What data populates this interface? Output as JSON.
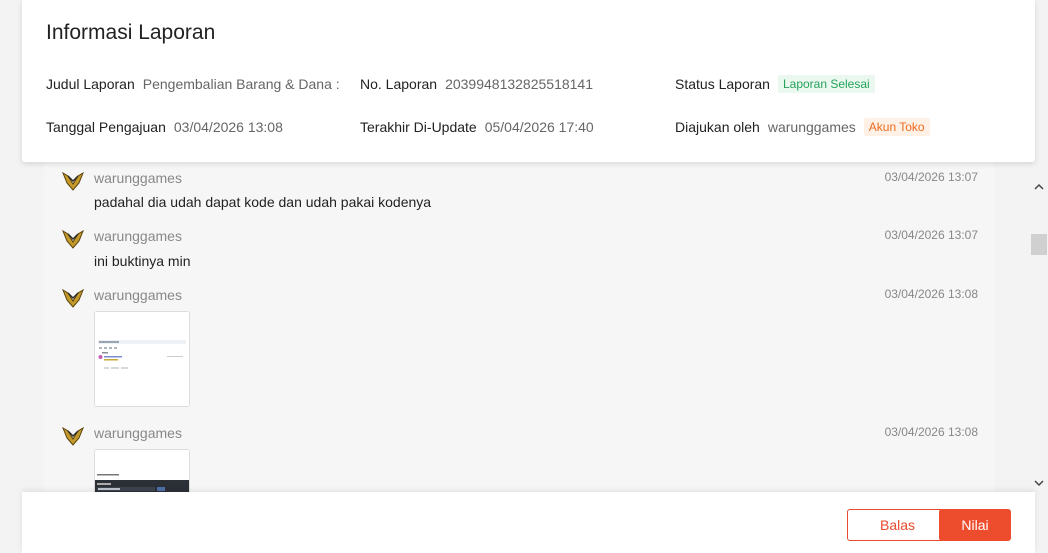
{
  "info": {
    "title": "Informasi Laporan",
    "judul_label": "Judul Laporan",
    "judul_value": "Pengembalian Barang & Dana :",
    "no_label": "No. Laporan",
    "no_value": "2039948132825518141",
    "status_label": "Status Laporan",
    "status_badge": "Laporan Selesai",
    "tanggal_label": "Tanggal Pengajuan",
    "tanggal_value": "03/04/2026 13:08",
    "update_label": "Terakhir Di-Update",
    "update_value": "05/04/2026 17:40",
    "diajukan_label": "Diajukan oleh",
    "diajukan_value": "warunggames",
    "diajukan_badge": "Akun Toko"
  },
  "messages": [
    {
      "sender": "warunggames",
      "time": "03/04/2026 13:07",
      "text": "padahal dia udah dapat kode dan udah pakai kodenya"
    },
    {
      "sender": "warunggames",
      "time": "03/04/2026 13:07",
      "text": "ini buktinya min"
    },
    {
      "sender": "warunggames",
      "time": "03/04/2026 13:08",
      "attachment": "image"
    },
    {
      "sender": "warunggames",
      "time": "03/04/2026 13:08",
      "attachment": "image"
    }
  ],
  "icons": {
    "avatar": "warunggames-logo-icon",
    "scroll_up": "chevron-up-icon",
    "scroll_down": "chevron-down-icon"
  },
  "colors": {
    "accent": "#ee4d2d",
    "status_green": "#25a35a",
    "badge_orange": "#ee6a1f"
  },
  "footer": {
    "reply_label": "Balas",
    "rate_label": "Nilai"
  }
}
